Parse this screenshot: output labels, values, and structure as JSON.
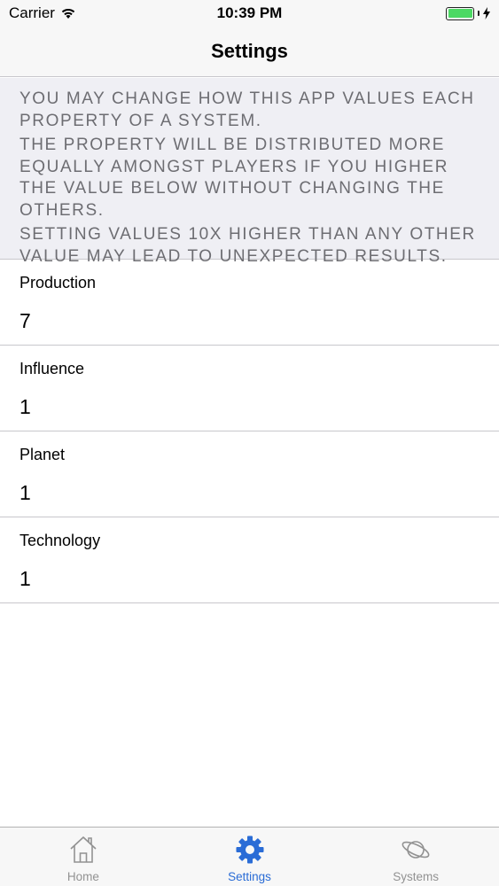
{
  "status_bar": {
    "carrier": "Carrier",
    "time": "10:39 PM"
  },
  "nav": {
    "title": "Settings"
  },
  "info": {
    "paragraphs": [
      "YOU MAY CHANGE HOW THIS APP VALUES EACH PROPERTY OF A SYSTEM.",
      "THE PROPERTY WILL BE DISTRIBUTED MORE EQUALLY AMONGST PLAYERS IF YOU HIGHER THE VALUE BELOW WITHOUT CHANGING THE OTHERS.",
      "SETTING VALUES 10X HIGHER THAN ANY OTHER VALUE MAY LEAD TO UNEXPECTED RESULTS."
    ]
  },
  "settings": [
    {
      "label": "Production",
      "value": "7"
    },
    {
      "label": "Influence",
      "value": "1"
    },
    {
      "label": "Planet",
      "value": "1"
    },
    {
      "label": "Technology",
      "value": "1"
    }
  ],
  "tabs": [
    {
      "label": "Home",
      "icon": "home-icon",
      "active": false
    },
    {
      "label": "Settings",
      "icon": "gear-icon",
      "active": true
    },
    {
      "label": "Systems",
      "icon": "planet-icon",
      "active": false
    }
  ],
  "colors": {
    "accent": "#2a6cd6",
    "inactive_tab": "#929292",
    "battery": "#4cd964",
    "section_bg": "#efeff4",
    "section_text": "#6d6d72"
  }
}
